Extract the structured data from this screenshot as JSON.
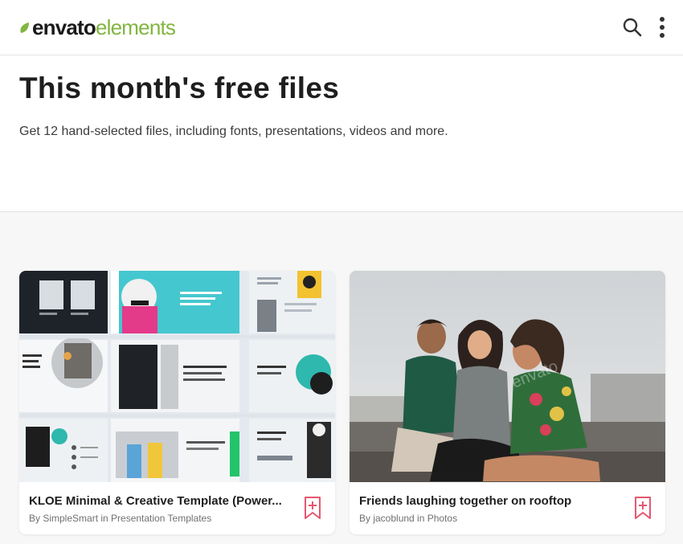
{
  "header": {
    "logo_primary": "envato",
    "logo_secondary": "elements",
    "search_icon": "search-icon",
    "menu_icon": "more-vertical-icon"
  },
  "hero": {
    "title": "This month's free files",
    "subtitle": "Get 12 hand-selected files, including fonts, presentations, videos and more."
  },
  "cards": [
    {
      "title": "KLOE Minimal & Creative Template (Power...",
      "author": "By SimpleSmart in Presentation Templates",
      "bookmark_icon": "bookmark-add-icon"
    },
    {
      "title": "Friends laughing together on rooftop",
      "author": "By jacoblund in Photos",
      "bookmark_icon": "bookmark-add-icon"
    }
  ],
  "colors": {
    "brand_green": "#82b541",
    "bookmark_pink": "#e5576f",
    "page_bg": "#f7f7f7"
  }
}
